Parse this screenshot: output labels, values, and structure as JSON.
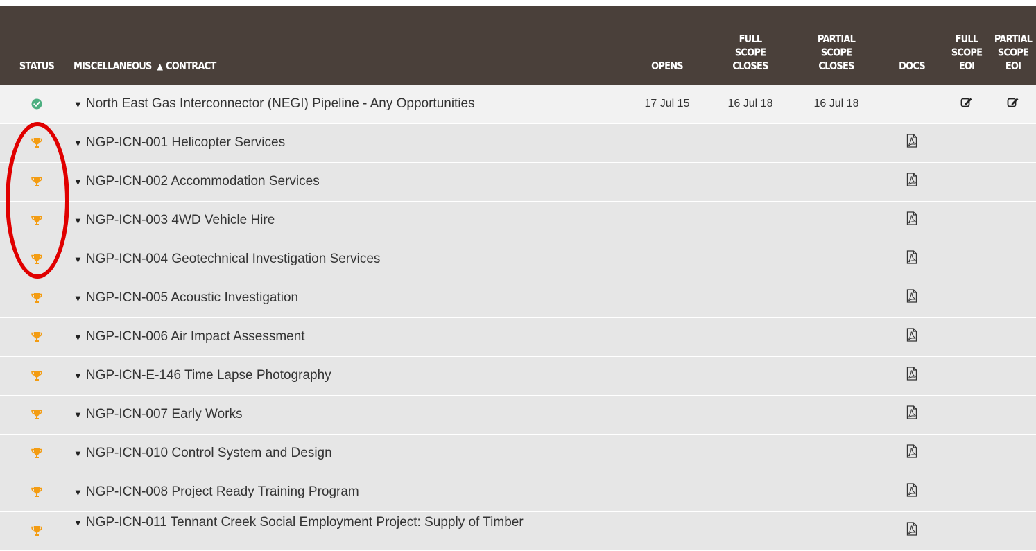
{
  "headers": {
    "status": "STATUS",
    "category": "MISCELLANEOUS",
    "sort_indicator": "▲",
    "contract": "CONTRACT",
    "opens": "OPENS",
    "full_scope_closes": [
      "FULL",
      "SCOPE",
      "CLOSES"
    ],
    "partial_scope_closes": [
      "PARTIAL",
      "SCOPE",
      "CLOSES"
    ],
    "docs": "DOCS",
    "full_scope_eoi": [
      "FULL",
      "SCOPE",
      "EOI"
    ],
    "partial_scope_eoi": [
      "PARTIAL",
      "SCOPE",
      "EOI"
    ]
  },
  "colors": {
    "header_bg": "#4a403a",
    "check_green": "#4caf80",
    "trophy_orange": "#f39c12",
    "annotation_red": "#e00000"
  },
  "rows": [
    {
      "status_icon": "check-icon",
      "contract": "North East Gas Interconnector (NEGI) Pipeline - Any Opportunities",
      "opens": "17 Jul 15",
      "full_closes": "16 Jul 18",
      "partial_closes": "16 Jul 18",
      "docs": "",
      "eoi": true
    },
    {
      "status_icon": "trophy-icon",
      "contract": "NGP-ICN-001 Helicopter Services",
      "docs": "pdf-icon"
    },
    {
      "status_icon": "trophy-icon",
      "contract": "NGP-ICN-002 Accommodation Services",
      "docs": "pdf-icon"
    },
    {
      "status_icon": "trophy-icon",
      "contract": "NGP-ICN-003 4WD Vehicle Hire",
      "docs": "pdf-icon"
    },
    {
      "status_icon": "trophy-icon",
      "contract": "NGP-ICN-004 Geotechnical Investigation Services",
      "docs": "pdf-icon"
    },
    {
      "status_icon": "trophy-icon",
      "contract": "NGP-ICN-005 Acoustic Investigation",
      "docs": "pdf-icon"
    },
    {
      "status_icon": "trophy-icon",
      "contract": "NGP-ICN-006 Air Impact Assessment",
      "docs": "pdf-icon"
    },
    {
      "status_icon": "trophy-icon",
      "contract": "NGP-ICN-E-146 Time Lapse Photography",
      "docs": "pdf-icon"
    },
    {
      "status_icon": "trophy-icon",
      "contract": "NGP-ICN-007 Early Works",
      "docs": "pdf-icon"
    },
    {
      "status_icon": "trophy-icon",
      "contract": "NGP-ICN-010 Control System and Design",
      "docs": "pdf-icon"
    },
    {
      "status_icon": "trophy-icon",
      "contract": "NGP-ICN-008 Project Ready Training Program",
      "docs": "pdf-icon"
    },
    {
      "status_icon": "trophy-icon",
      "contract": "NGP-ICN-011 Tennant Creek Social Employment Project: Supply of Timber",
      "docs": "pdf-icon"
    }
  ]
}
